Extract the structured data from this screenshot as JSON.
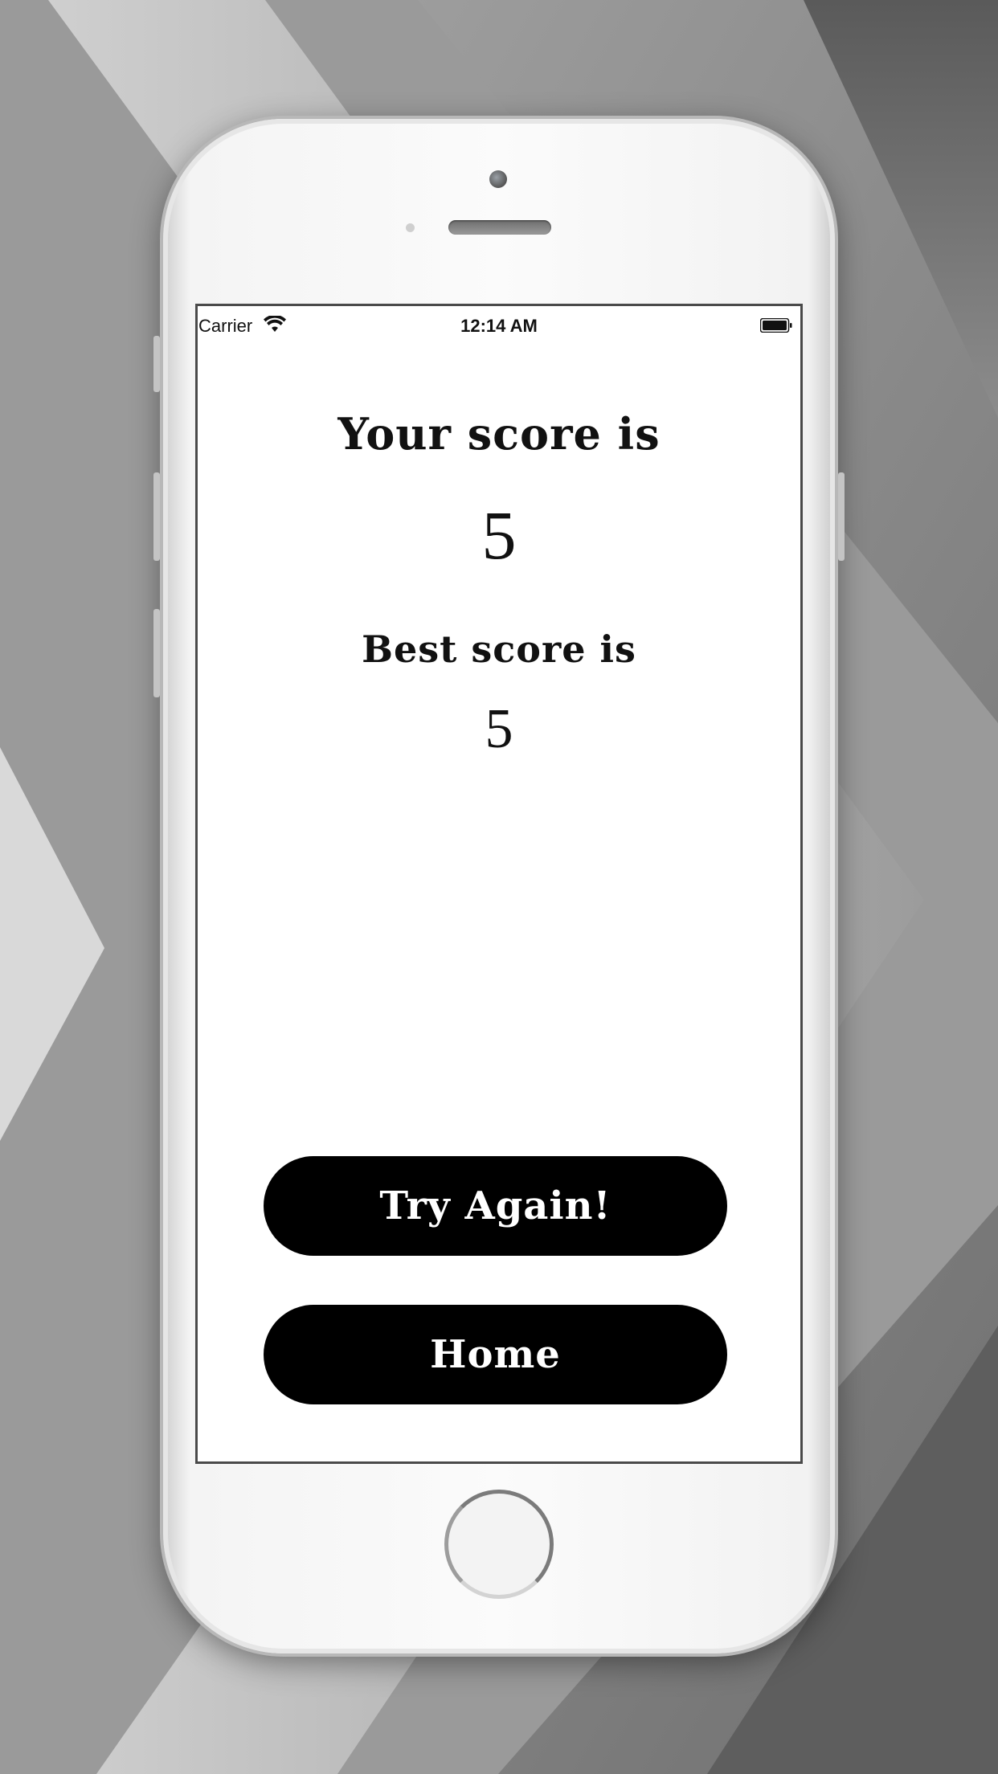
{
  "status_bar": {
    "carrier": "Carrier",
    "time": "12:14 AM",
    "wifi_icon": "wifi-icon",
    "battery_icon": "battery-icon"
  },
  "score": {
    "your_label": "Your score is",
    "your_value": "5",
    "best_label": "Best score is",
    "best_value": "5"
  },
  "buttons": {
    "try_again": "Try Again!",
    "home": "Home"
  },
  "colors": {
    "button_bg": "#000000",
    "button_text": "#ffffff",
    "screen_bg": "#ffffff",
    "text": "#111111"
  }
}
